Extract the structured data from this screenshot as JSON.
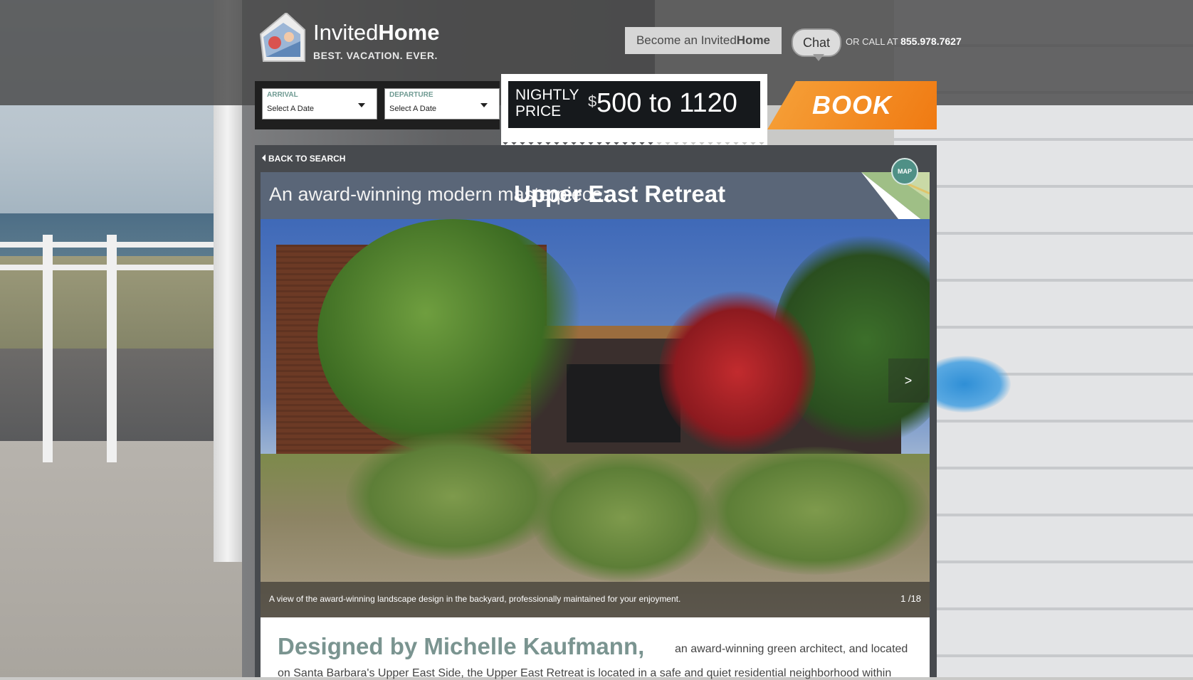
{
  "header": {
    "logo_light": "Invited",
    "logo_bold": "Home",
    "tagline": "BEST. VACATION. EVER.",
    "become_prefix": "Become an Invited",
    "become_bold": "Home",
    "chat_label": "Chat",
    "call_prefix": "OR CALL AT",
    "phone": "855.978.7627"
  },
  "booking": {
    "arrival_label": "ARRIVAL",
    "arrival_value": "Select A Date",
    "departure_label": "DEPARTURE",
    "departure_value": "Select A Date",
    "price_label_1": "NIGHTLY",
    "price_label_2": "PRICE",
    "price_currency": "$",
    "price_range": "500 to 1120",
    "book_label": "BOOK"
  },
  "listing": {
    "back_label": "BACK TO SEARCH",
    "title_prefix": "An award-winning modern masterpiece:",
    "title_name": "Upper East Retreat",
    "map_label": "MAP",
    "next_label": ">",
    "caption": "A view of the award-winning landscape design in the backyard, professionally maintained for your enjoyment.",
    "counter": "1 /18",
    "designer": "Designed by Michelle Kaufmann,",
    "desc_rest": "an award-winning green architect, and located",
    "desc_line2": "on Santa Barbara's Upper East Side, the Upper East Retreat is located in a safe and quiet residential neighborhood within"
  },
  "colors": {
    "accent_orange": "#f07a12",
    "teal": "#7a9490",
    "title_bar": "#5a6678"
  }
}
